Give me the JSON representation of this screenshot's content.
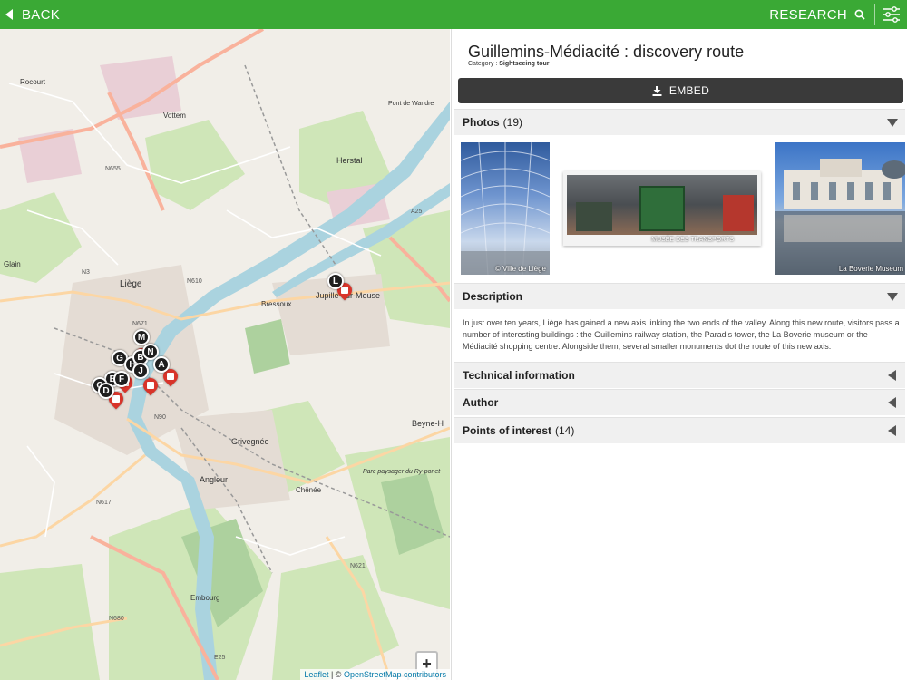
{
  "topbar": {
    "back_label": "BACK",
    "research_label": "RESEARCH",
    "accent": "#3aa935",
    "icons": [
      "chevron-left-icon",
      "search-icon",
      "sliders-icon"
    ]
  },
  "map": {
    "labels": {
      "liege": "Liège",
      "herstal": "Herstal",
      "jupille": "Jupille-sur-Meuse",
      "bressoux": "Bressoux",
      "grivegnee": "Grivegnée",
      "angleur": "Angleur",
      "chenee": "Chênée",
      "beyne": "Beyne-H",
      "vottem": "Vottem",
      "rocourt": "Rocourt",
      "glain": "Glain",
      "embourg": "Embourg",
      "pont_de_wandre": "Pont de Wandre",
      "parc": "Parc paysager du Ry-ponet",
      "n655": "N655",
      "n671": "N671",
      "n610": "N610",
      "n90": "N90",
      "n617": "N617",
      "n621": "N621",
      "n680": "N680",
      "n3": "N3",
      "a25": "A25",
      "e25": "E25"
    },
    "markers": [
      "M",
      "G",
      "H",
      "B",
      "N",
      "J",
      "A",
      "E",
      "F",
      "C",
      "D",
      "L"
    ],
    "zoom_in": "+",
    "zoom_out": "-",
    "attribution_leaflet": "Leaflet",
    "attribution_sep": " | © ",
    "attribution_osm": "OpenStreetMap contributors"
  },
  "panel": {
    "title": "Guillemins-Médiacité : discovery route",
    "category_label": "Category :",
    "category_value": "Sightseeing tour",
    "embed_label": "EMBED",
    "photos": {
      "label": "Photos",
      "count": "(19)",
      "items": [
        {
          "caption": "© Ville de Liège"
        },
        {
          "caption": "MUSÉE DES TRANSPORTS"
        },
        {
          "caption": "La Boverie Museum"
        }
      ]
    },
    "description": {
      "label": "Description",
      "text": "In just over ten years, Liège has gained a new axis linking the two ends of the valley. Along this new route, visitors pass a number of interesting buildings : the Guillemins railway station, the Paradis tower, the La Boverie museum or the Médiacité shopping centre. Alongside them, several smaller monuments dot the route of this new axis."
    },
    "technical": {
      "label": "Technical information"
    },
    "author": {
      "label": "Author"
    },
    "poi": {
      "label": "Points of interest",
      "count": "(14)"
    }
  }
}
